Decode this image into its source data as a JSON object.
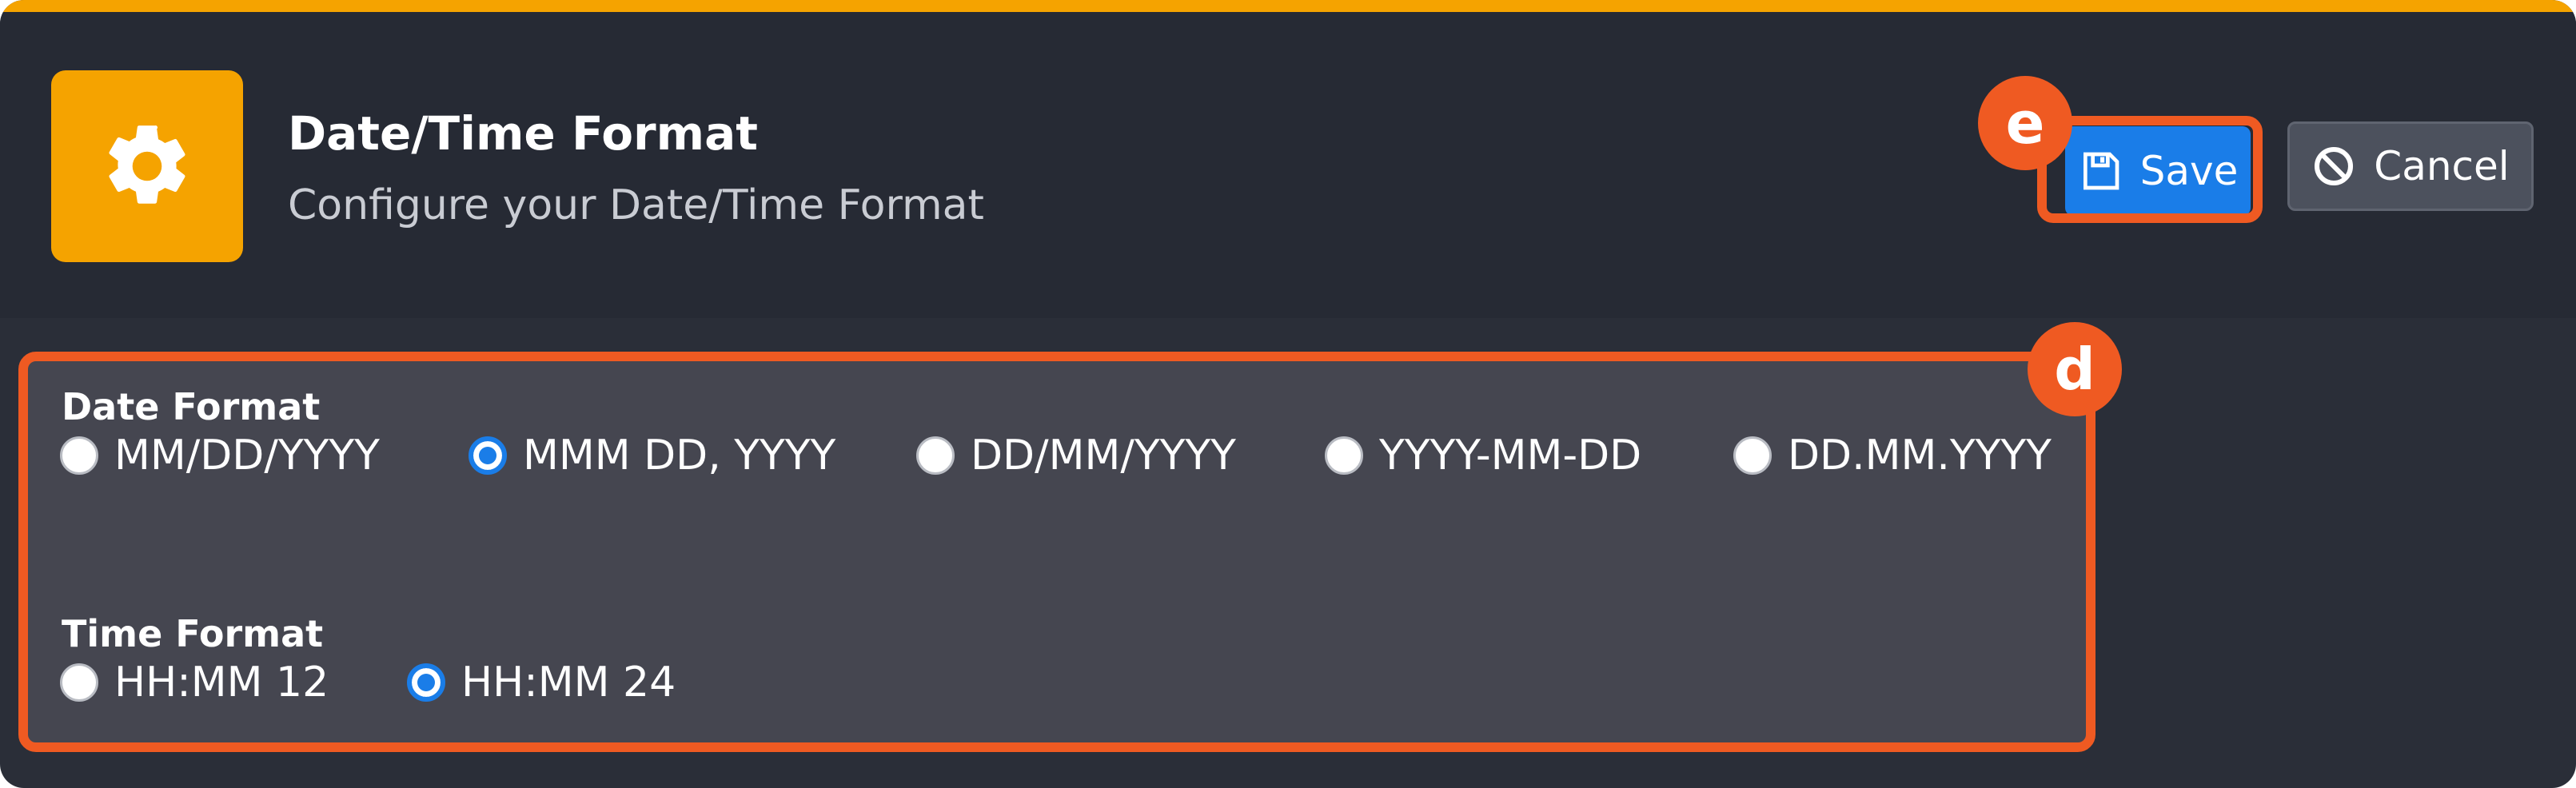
{
  "header": {
    "title": "Date/Time Format",
    "subtitle": "Configure your Date/Time Format",
    "icon": "gear-icon"
  },
  "actions": {
    "save_label": "Save",
    "save_icon": "floppy-disk-icon",
    "cancel_label": "Cancel",
    "cancel_icon": "ban-icon"
  },
  "annotations": {
    "save_badge": "e",
    "panel_badge": "d"
  },
  "date_format": {
    "label": "Date Format",
    "selected": "MMM DD, YYYY",
    "options": [
      "MM/DD/YYYY",
      "MMM DD, YYYY",
      "DD/MM/YYYY",
      "YYYY-MM-DD",
      "DD.MM.YYYY"
    ]
  },
  "time_format": {
    "label": "Time Format",
    "selected": "HH:MM 24",
    "options": [
      "HH:MM 12",
      "HH:MM 24"
    ]
  },
  "colors": {
    "accent": "#f5a300",
    "primary": "#1a7de8",
    "highlight": "#ef5a22",
    "background": "#2a2e38"
  }
}
